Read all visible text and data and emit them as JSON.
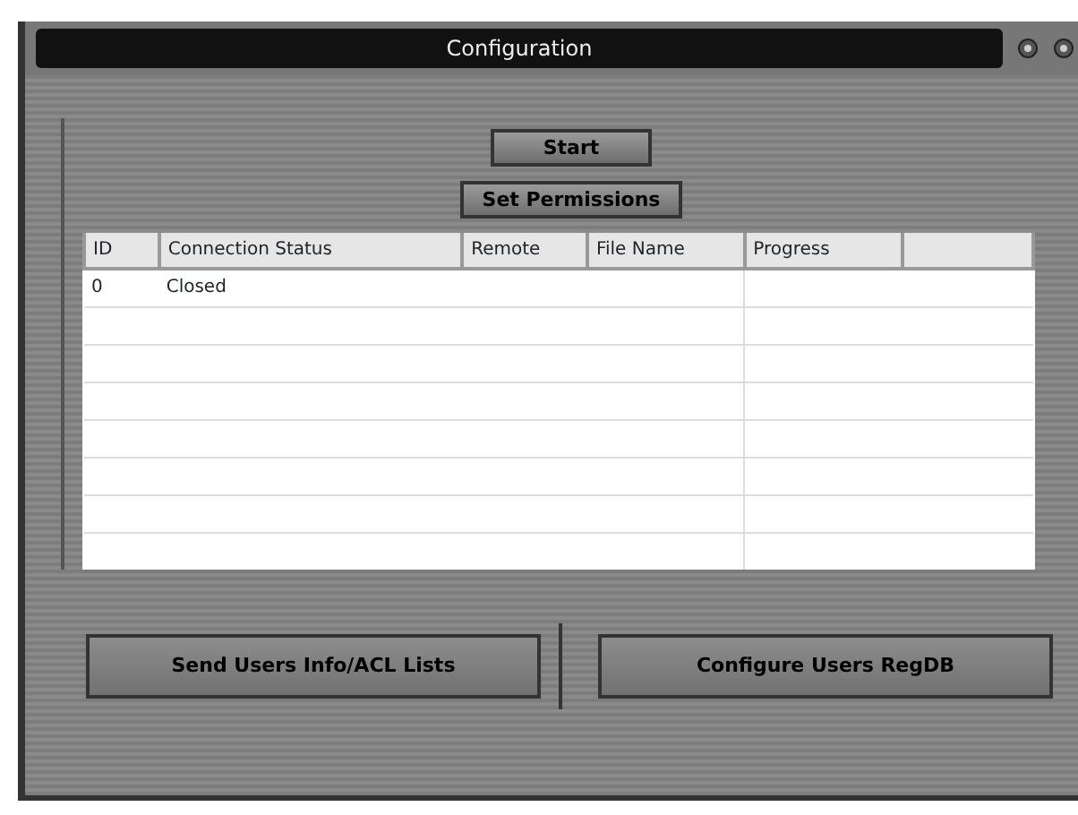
{
  "window": {
    "title": "Configuration"
  },
  "top_buttons": [
    "Start",
    "Set Permissions"
  ],
  "table": {
    "columns": [
      "ID",
      "Connection Status",
      "Remote",
      "File Name",
      "Progress",
      ""
    ],
    "rows": [
      [
        "0",
        "Closed",
        "",
        "",
        "",
        ""
      ]
    ]
  },
  "bottom_buttons": [
    "Send Users Info/ACL Lists",
    "Configure Users RegDB"
  ]
}
